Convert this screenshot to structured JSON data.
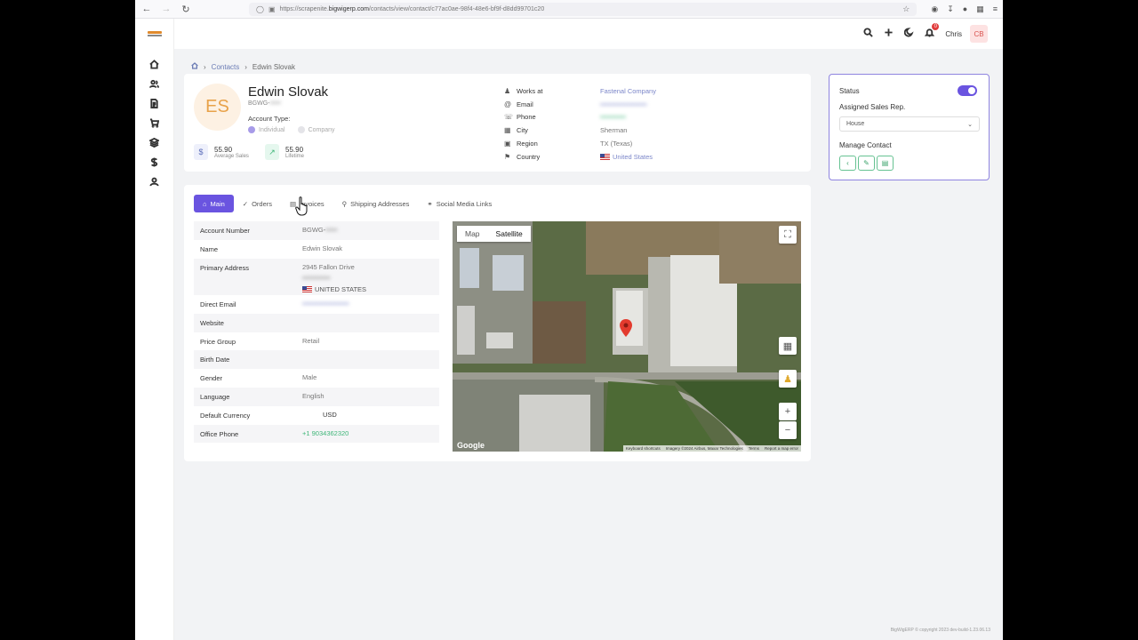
{
  "browser": {
    "url_prefix": "https://scrapenite.",
    "url_domain": "bigwigerp.com",
    "url_path": "/contacts/view/contact/c77ac0ae-98f4-48e6-bf9f-d8dd99701c20"
  },
  "topbar": {
    "notification_count": "0",
    "user_name": "Chris",
    "user_initials": "CB"
  },
  "breadcrumb": {
    "section": "Contacts",
    "current": "Edwin Slovak"
  },
  "contact": {
    "initials": "ES",
    "name": "Edwin Slovak",
    "code": "BGWG-",
    "code_hidden": "•••••",
    "account_type_label": "Account Type:",
    "type_individual": "Individual",
    "type_company": "Company",
    "average_sales": "55.90",
    "average_sales_label": "Average Sales",
    "lifetime": "55.90",
    "lifetime_label": "Lifetime"
  },
  "info": {
    "works_at_label": "Works at",
    "works_at": "Fastenal Company",
    "email_label": "Email",
    "email": "••••••••••••••••••••",
    "phone_label": "Phone",
    "phone": "•••••••••••",
    "city_label": "City",
    "city": "Sherman",
    "region_label": "Region",
    "region": "TX (Texas)",
    "country_label": "Country",
    "country": "United States"
  },
  "status_card": {
    "status_label": "Status",
    "status_on": true,
    "sales_rep_label": "Assigned Sales Rep.",
    "sales_rep_value": "House",
    "manage_label": "Manage Contact"
  },
  "tabs": [
    "Main",
    "Orders",
    "Invoices",
    "Shipping Addresses",
    "Social Media Links"
  ],
  "details": {
    "account_number_label": "Account Number",
    "account_number": "BGWG-",
    "name_label": "Name",
    "name": "Edwin Slovak",
    "address_label": "Primary Address",
    "address_line1": "2945 Fallon Drive",
    "address_line2": "••••••••••••",
    "address_country": "UNITED STATES",
    "email_label": "Direct Email",
    "email": "••••••••••••••••••••",
    "website_label": "Website",
    "website": "",
    "price_group_label": "Price Group",
    "price_group": "Retail",
    "birth_label": "Birth Date",
    "birth": "",
    "gender_label": "Gender",
    "gender": "Male",
    "language_label": "Language",
    "language": "English",
    "currency_label": "Default Currency",
    "currency": "USD",
    "office_phone_label": "Office Phone",
    "office_phone": "+1 9034362320"
  },
  "map": {
    "map_label": "Map",
    "satellite_label": "Satellite",
    "google": "Google",
    "shortcuts": "Keyboard shortcuts",
    "imagery": "Imagery ©2024 Airbus, Maxar Technologies",
    "terms": "Terms",
    "report": "Report a map error"
  },
  "footer": "BigWigERP © copyright 2023 dev-build-1.23.06.13"
}
